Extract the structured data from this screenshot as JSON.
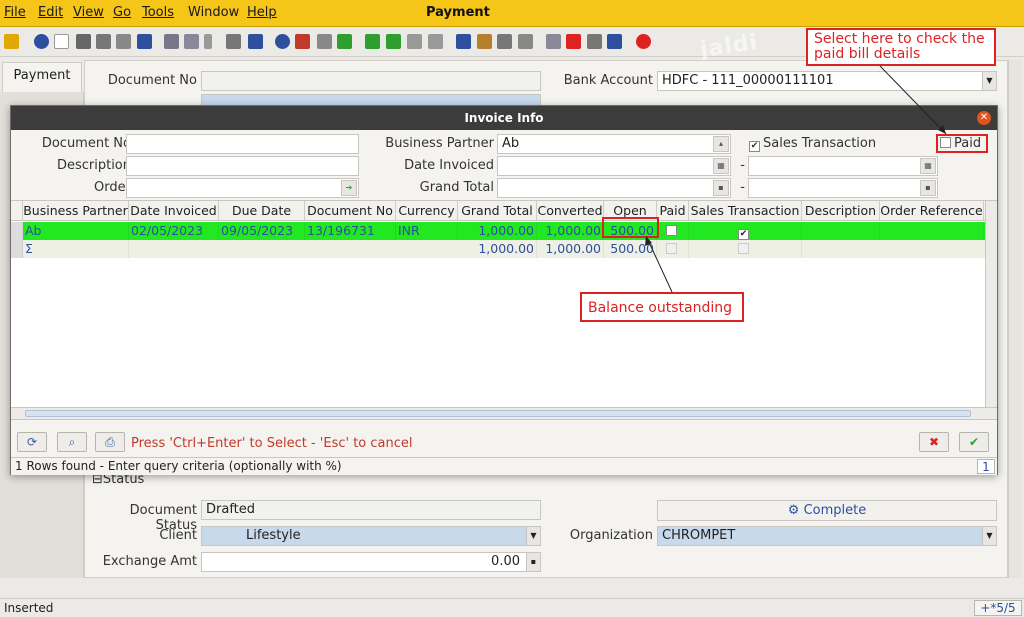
{
  "menu": {
    "file": "File",
    "edit": "Edit",
    "view": "View",
    "go": "Go",
    "tools": "Tools",
    "window": "Window",
    "help": "Help",
    "title": "Payment"
  },
  "watermark": "jaldi",
  "tab": {
    "label": "Payment"
  },
  "form": {
    "document_no_label": "Document No",
    "document_no_value": "",
    "bank_account_label": "Bank Account",
    "bank_account_value": "HDFC - 111_00000111101",
    "status_section": "Status",
    "document_status_label": "Document Status",
    "document_status_value": "Drafted",
    "client_label": "Client",
    "client_value": "Lifestyle",
    "organization_label": "Organization",
    "organization_value": "CHROMPET",
    "exchange_amt_label": "Exchange Amt",
    "exchange_amt_value": "0.00",
    "complete_button": "Complete"
  },
  "dialog": {
    "title": "Invoice Info",
    "document_no_label": "Document No",
    "document_no_value": "",
    "description_label": "Description",
    "description_value": "",
    "order_label": "Order",
    "order_value": "",
    "business_partner_label": "Business Partner",
    "business_partner_value": "Ab",
    "date_invoiced_label": "Date Invoiced",
    "grand_total_label": "Grand Total",
    "range_dash": "-",
    "sales_transaction_label": "Sales Transaction",
    "sales_transaction_checked": true,
    "paid_label": "Paid",
    "paid_checked": false,
    "columns": [
      "Business Partner",
      "Date Invoiced",
      "Due Date",
      "Document No",
      "Currency",
      "Grand Total",
      "Converted",
      "Open",
      "Paid",
      "Sales Transaction",
      "Description",
      "Order Reference"
    ],
    "rows": [
      {
        "business_partner": "Ab",
        "date_invoiced": "02/05/2023",
        "due_date": "09/05/2023",
        "document_no": "13/196731",
        "currency": "INR",
        "grand_total": "1,000.00",
        "converted": "1,000.00",
        "open": "500.00"
      }
    ],
    "sum_row": {
      "symbol": "Σ",
      "grand_total": "1,000.00",
      "converted": "1,000.00",
      "open": "500.00"
    },
    "hint": "Press 'Ctrl+Enter' to Select - 'Esc' to cancel",
    "status_text": "1 Rows found - Enter query criteria (optionally with %)",
    "status_count": "1"
  },
  "annotations": {
    "paid_callout": "Select here to check the paid bill details",
    "balance_callout": "Balance outstanding"
  },
  "statusbar": {
    "text": "Inserted",
    "record": "+*5/5"
  },
  "colors": {
    "menubar": "#f5c518",
    "selected_row": "#22e822",
    "accent_red": "#d22222"
  }
}
